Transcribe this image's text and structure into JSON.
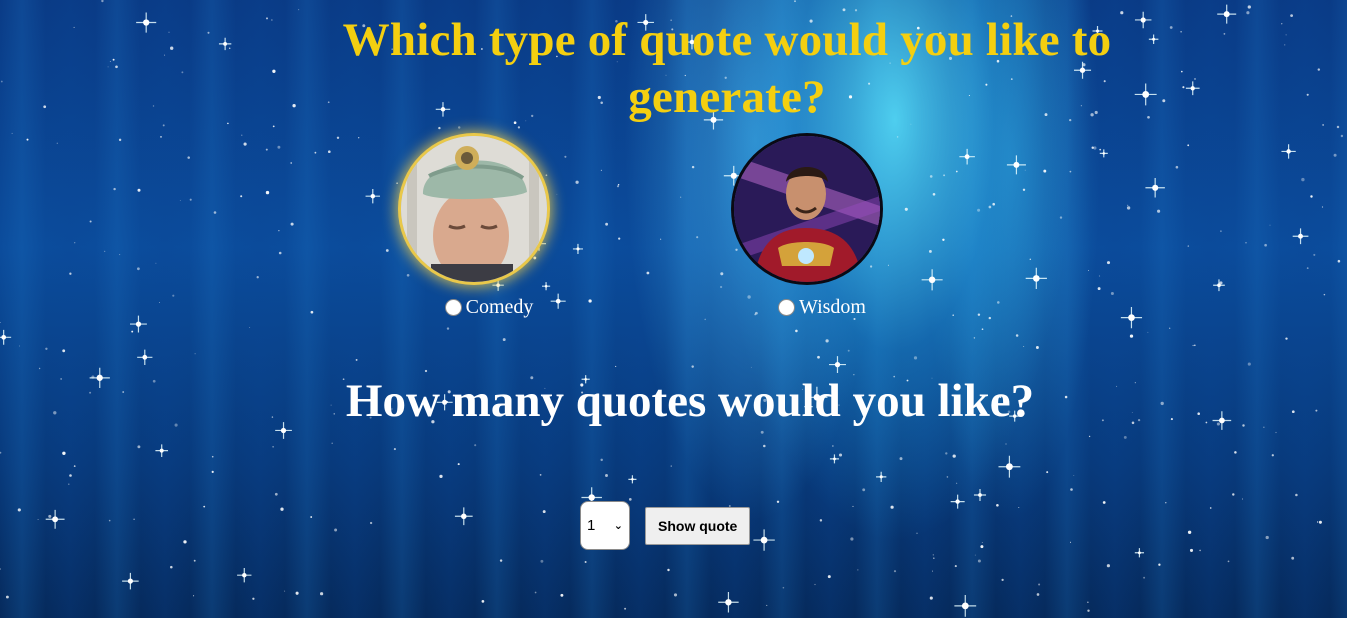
{
  "page": {
    "title": "Which type of quote would you like to generate?",
    "count_question": "How many quotes would you like?"
  },
  "choices": [
    {
      "label": "Comedy",
      "selected": false
    },
    {
      "label": "Wisdom",
      "selected": false
    }
  ],
  "quantity": {
    "selected": "1"
  },
  "show_button": {
    "label": "Show quote"
  },
  "colors": {
    "title": "#f4cf10",
    "heading": "#ffffff",
    "background": "#0b4c9c"
  }
}
